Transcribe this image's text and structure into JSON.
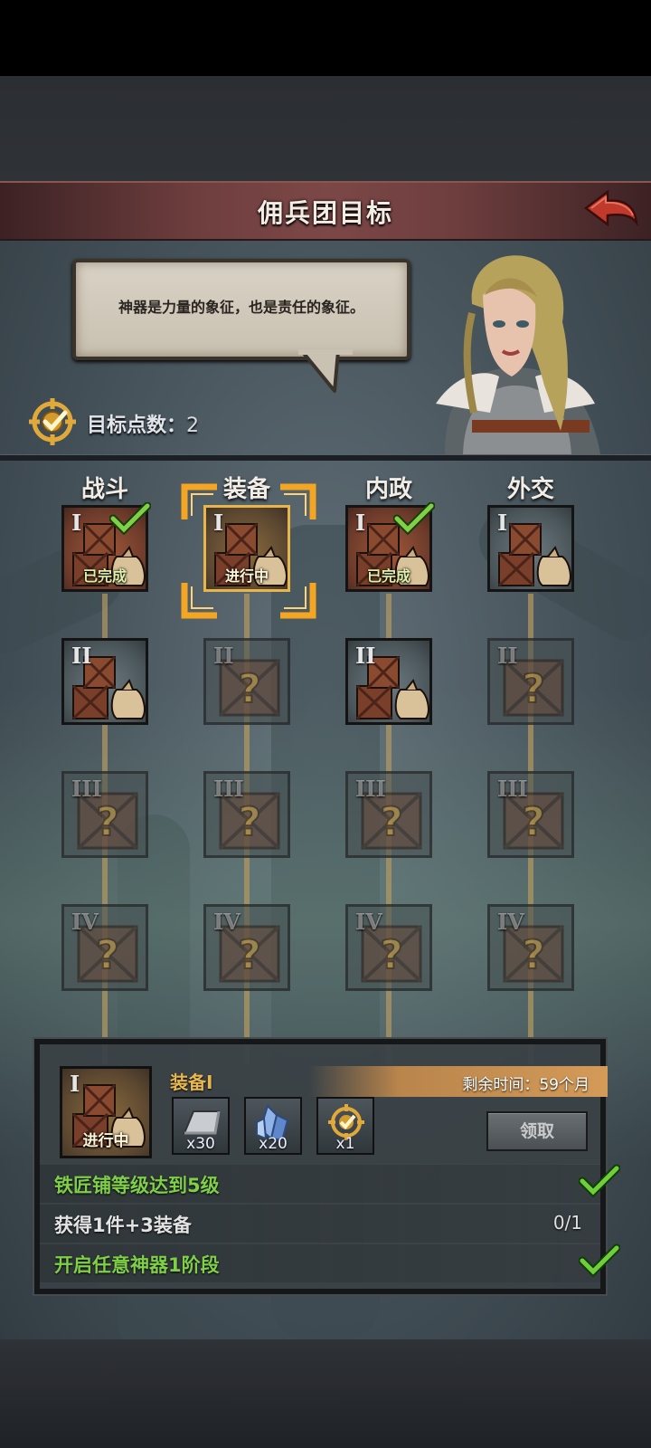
{
  "header": {
    "title": "佣兵团目标"
  },
  "dialogue": {
    "text": "神器是力量的象征，也是责任的象征。"
  },
  "points": {
    "label": "目标点数：",
    "value": "2"
  },
  "columns": [
    {
      "label": "战斗",
      "tiles": [
        {
          "roman": "I",
          "state": "completed",
          "status": "已完成"
        },
        {
          "roman": "II",
          "state": "available",
          "status": ""
        },
        {
          "roman": "III",
          "state": "locked",
          "status": ""
        },
        {
          "roman": "IV",
          "state": "locked",
          "status": ""
        }
      ]
    },
    {
      "label": "装备",
      "tiles": [
        {
          "roman": "I",
          "state": "in-progress",
          "status": "进行中"
        },
        {
          "roman": "II",
          "state": "locked",
          "status": ""
        },
        {
          "roman": "III",
          "state": "locked",
          "status": ""
        },
        {
          "roman": "IV",
          "state": "locked",
          "status": ""
        }
      ]
    },
    {
      "label": "内政",
      "tiles": [
        {
          "roman": "I",
          "state": "completed",
          "status": "已完成"
        },
        {
          "roman": "II",
          "state": "available",
          "status": ""
        },
        {
          "roman": "III",
          "state": "locked",
          "status": ""
        },
        {
          "roman": "IV",
          "state": "locked",
          "status": ""
        }
      ]
    },
    {
      "label": "外交",
      "tiles": [
        {
          "roman": "I",
          "state": "available",
          "status": ""
        },
        {
          "roman": "II",
          "state": "locked",
          "status": ""
        },
        {
          "roman": "III",
          "state": "locked",
          "status": ""
        },
        {
          "roman": "IV",
          "state": "locked",
          "status": ""
        }
      ]
    }
  ],
  "detail": {
    "tile_roman": "I",
    "tile_status": "进行中",
    "goal_name": "装备I",
    "time_left": "剩余时间：59个月",
    "rewards": [
      {
        "icon": "iron-ingot-icon",
        "qty": "x30"
      },
      {
        "icon": "blue-crystal-icon",
        "qty": "x20"
      },
      {
        "icon": "target-point-icon",
        "qty": "x1"
      }
    ],
    "claim_label": "领取",
    "requirements": [
      {
        "text": "铁匠铺等级达到5级",
        "met": true,
        "progress": ""
      },
      {
        "text": "获得1件+3装备",
        "met": false,
        "progress": "0/1"
      },
      {
        "text": "开启任意神器1阶段",
        "met": true,
        "progress": ""
      }
    ]
  },
  "colors": {
    "title_bar": "#7c4747",
    "accent_gold": "#e8b54a",
    "completed_green": "#7fcf47",
    "back_arrow": "#c0392b"
  }
}
